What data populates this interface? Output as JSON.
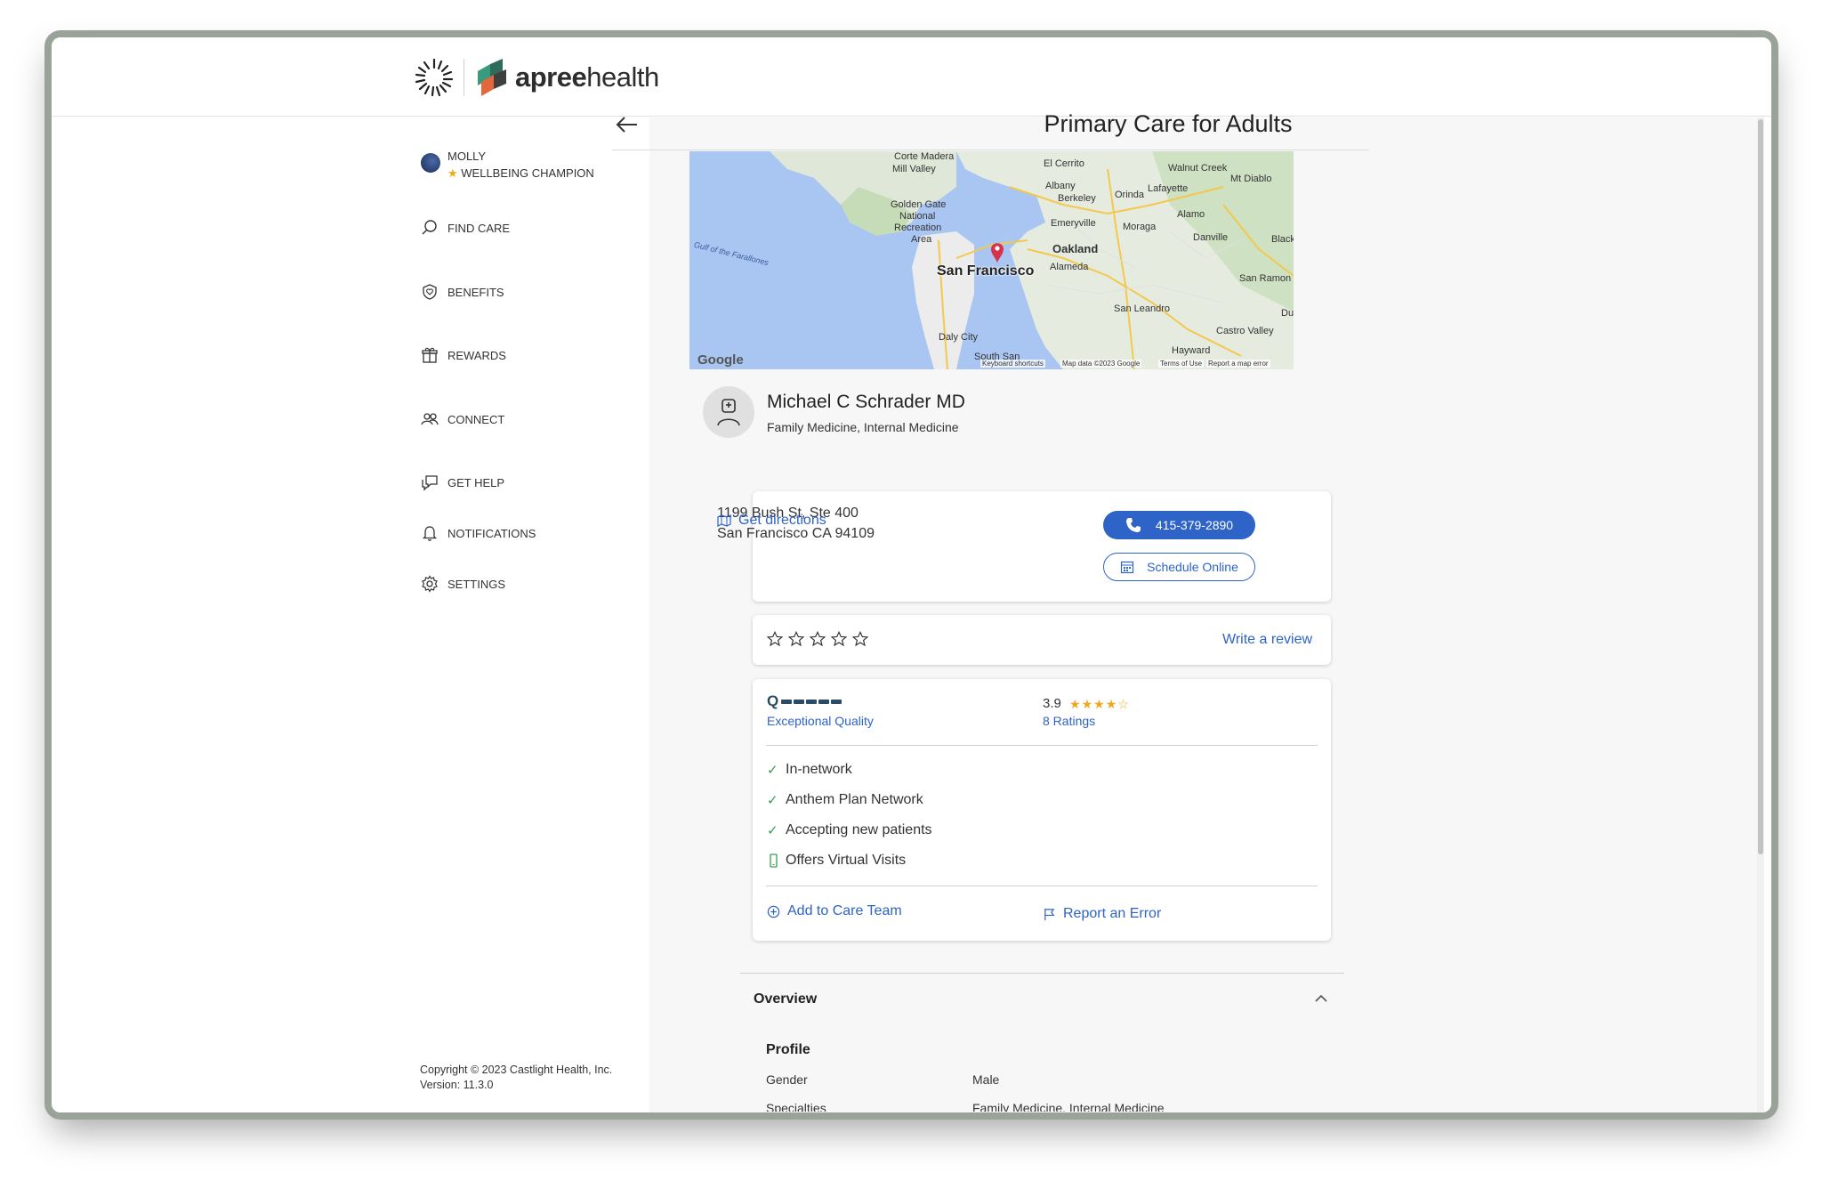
{
  "brand": {
    "name_bold": "apree",
    "name_light": "health"
  },
  "user": {
    "name": "MOLLY",
    "badge": "WELLBEING CHAMPION"
  },
  "nav": [
    {
      "label": "FIND CARE",
      "icon": "search-icon"
    },
    {
      "label": "BENEFITS",
      "icon": "shield-heart-icon"
    },
    {
      "label": "REWARDS",
      "icon": "gift-icon"
    },
    {
      "label": "CONNECT",
      "icon": "people-icon"
    },
    {
      "label": "GET HELP",
      "icon": "chat-help-icon"
    },
    {
      "label": "NOTIFICATIONS",
      "icon": "bell-icon"
    },
    {
      "label": "SETTINGS",
      "icon": "gear-icon"
    }
  ],
  "footer": {
    "copyright": "Copyright © 2023 Castlight Health, Inc.",
    "version": "Version: 11.3.0"
  },
  "page": {
    "title": "Primary Care for Adults"
  },
  "map": {
    "city": "San Francisco",
    "labels": [
      "Corte Madera",
      "Mill Valley",
      "El Cerrito",
      "Walnut Creek",
      "Mt Diablo",
      "Albany",
      "Berkeley",
      "Lafayette",
      "Orinda",
      "Golden Gate",
      "National",
      "Recreation",
      "Area",
      "Emeryville",
      "Moraga",
      "Alamo",
      "Danville",
      "Black",
      "Oakland",
      "Alameda",
      "San Ramon",
      "Gulf of the Farallones",
      "San Leandro",
      "Dub",
      "Daly City",
      "Castro Valley",
      "Hayward",
      "South San"
    ],
    "footer": {
      "shortcuts": "Keyboard shortcuts",
      "data": "Map data ©2023 Google",
      "terms": "Terms of Use",
      "report": "Report a map error"
    },
    "logo": "Google"
  },
  "doctor": {
    "name": "Michael C Schrader MD",
    "specialties": "Family Medicine, Internal Medicine",
    "address_line1": "1199 Bush St, Ste 400",
    "address_line2": "San Francisco CA 94109",
    "directions": "Get directions",
    "phone": "415-379-2890",
    "schedule": "Schedule Online"
  },
  "review": {
    "user_stars": 0,
    "write_label": "Write a review"
  },
  "quality": {
    "q_letter": "Q",
    "label": "Exceptional Quality",
    "rating": "3.9",
    "rating_stars": 4,
    "ratings_count": "8 Ratings"
  },
  "features": [
    {
      "label": "In-network",
      "icon": "check-icon"
    },
    {
      "label": "Anthem Plan Network",
      "icon": "check-icon"
    },
    {
      "label": "Accepting new patients",
      "icon": "check-icon"
    },
    {
      "label": "Offers Virtual Visits",
      "icon": "phone-device-icon"
    }
  ],
  "actions": {
    "add_care_team": "Add to Care Team",
    "report_error": "Report an Error"
  },
  "overview": {
    "title": "Overview",
    "profile_heading": "Profile",
    "rows": [
      {
        "key": "Gender",
        "value": "Male"
      },
      {
        "key": "Specialties",
        "value": "Family Medicine, Internal Medicine"
      }
    ]
  },
  "colors": {
    "accent": "#2e63c7",
    "star": "#f0a81b",
    "check": "#35a050",
    "pin": "#d6334a"
  }
}
